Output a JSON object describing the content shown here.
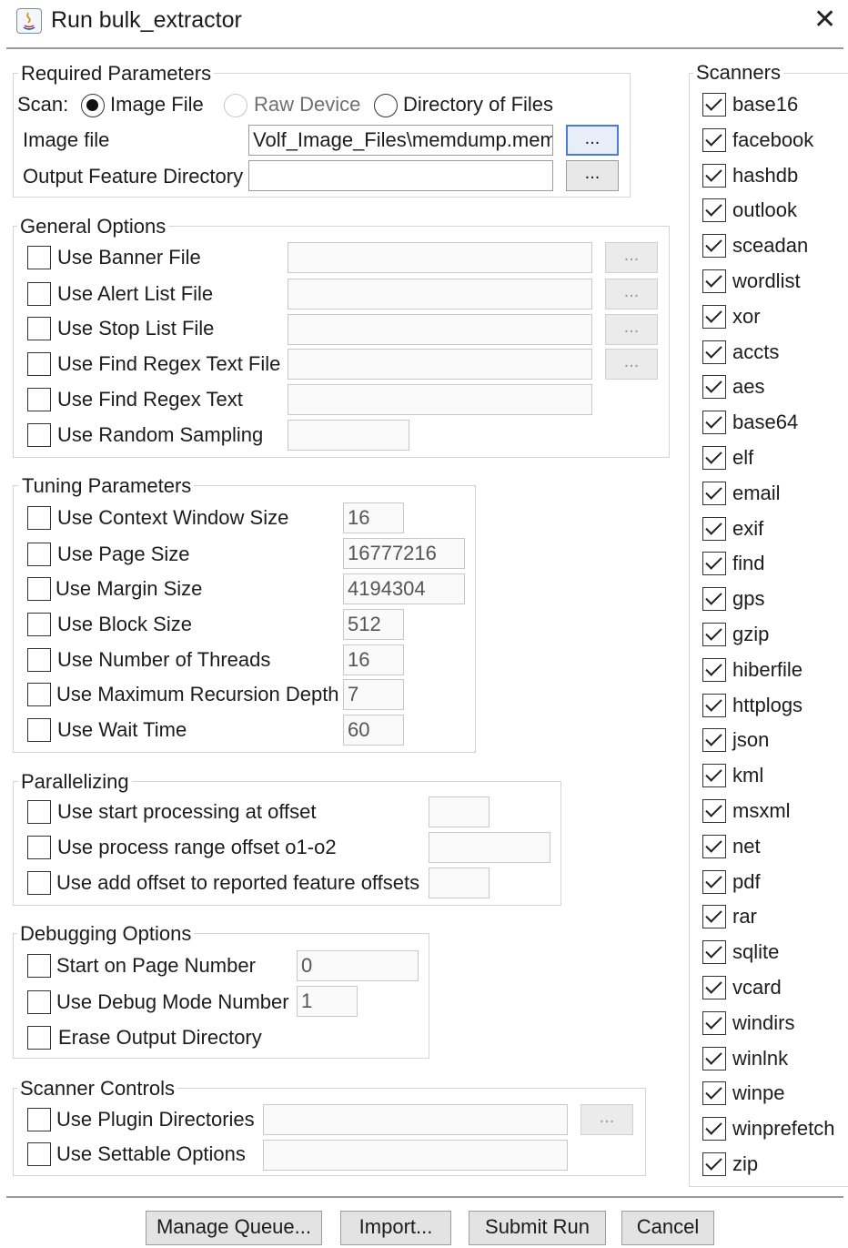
{
  "window": {
    "title": "Run bulk_extractor"
  },
  "required": {
    "group_label": "Required Parameters",
    "scan_label": "Scan:",
    "scan_options": [
      "Image File",
      "Raw Device",
      "Directory of Files"
    ],
    "scan_selected": "Image File",
    "image_file_label": "Image file",
    "image_file_value": "Volf_Image_Files\\memdump.mem",
    "output_dir_label": "Output Feature Directory",
    "output_dir_value": "",
    "browse_label": "..."
  },
  "general": {
    "group_label": "General Options",
    "items": [
      {
        "label": "Use Banner File",
        "checked": false
      },
      {
        "label": "Use Alert List File",
        "checked": false
      },
      {
        "label": "Use Stop List File",
        "checked": false
      },
      {
        "label": "Use Find Regex Text File",
        "checked": false
      },
      {
        "label": "Use Find Regex Text",
        "checked": false
      },
      {
        "label": "Use Random Sampling",
        "checked": false
      }
    ]
  },
  "tuning": {
    "group_label": "Tuning Parameters",
    "items": [
      {
        "label": "Use Context Window Size",
        "value": "16",
        "checked": false
      },
      {
        "label": "Use Page Size",
        "value": "16777216",
        "checked": false
      },
      {
        "label": "Use Margin Size",
        "value": "4194304",
        "checked": false
      },
      {
        "label": "Use Block Size",
        "value": "512",
        "checked": false
      },
      {
        "label": "Use Number of Threads",
        "value": "16",
        "checked": false
      },
      {
        "label": "Use Maximum Recursion Depth",
        "value": "7",
        "checked": false
      },
      {
        "label": "Use Wait Time",
        "value": "60",
        "checked": false
      }
    ]
  },
  "parallel": {
    "group_label": "Parallelizing",
    "items": [
      {
        "label": "Use start processing at offset",
        "checked": false
      },
      {
        "label": "Use process range offset o1-o2",
        "checked": false
      },
      {
        "label": "Use add offset to reported feature offsets",
        "checked": false
      }
    ]
  },
  "debugging": {
    "group_label": "Debugging Options",
    "items": [
      {
        "label": "Start on Page Number",
        "value": "0",
        "checked": false
      },
      {
        "label": "Use Debug Mode Number",
        "value": "1",
        "checked": false
      },
      {
        "label": "Erase Output Directory",
        "checked": false
      }
    ]
  },
  "scanner_controls": {
    "group_label": "Scanner Controls",
    "items": [
      {
        "label": "Use Plugin Directories",
        "checked": false
      },
      {
        "label": "Use Settable Options",
        "checked": false
      }
    ]
  },
  "scanners": {
    "group_label": "Scanners",
    "items": [
      "base16",
      "facebook",
      "hashdb",
      "outlook",
      "sceadan",
      "wordlist",
      "xor",
      "accts",
      "aes",
      "base64",
      "elf",
      "email",
      "exif",
      "find",
      "gps",
      "gzip",
      "hiberfile",
      "httplogs",
      "json",
      "kml",
      "msxml",
      "net",
      "pdf",
      "rar",
      "sqlite",
      "vcard",
      "windirs",
      "winlnk",
      "winpe",
      "winprefetch",
      "zip"
    ],
    "all_checked": true
  },
  "buttons": {
    "manage_queue": "Manage Queue...",
    "import": "Import...",
    "submit_run": "Submit Run",
    "cancel": "Cancel"
  },
  "colors": {
    "focus_border": "#4a7bd6",
    "group_border": "#d4d4d4"
  }
}
